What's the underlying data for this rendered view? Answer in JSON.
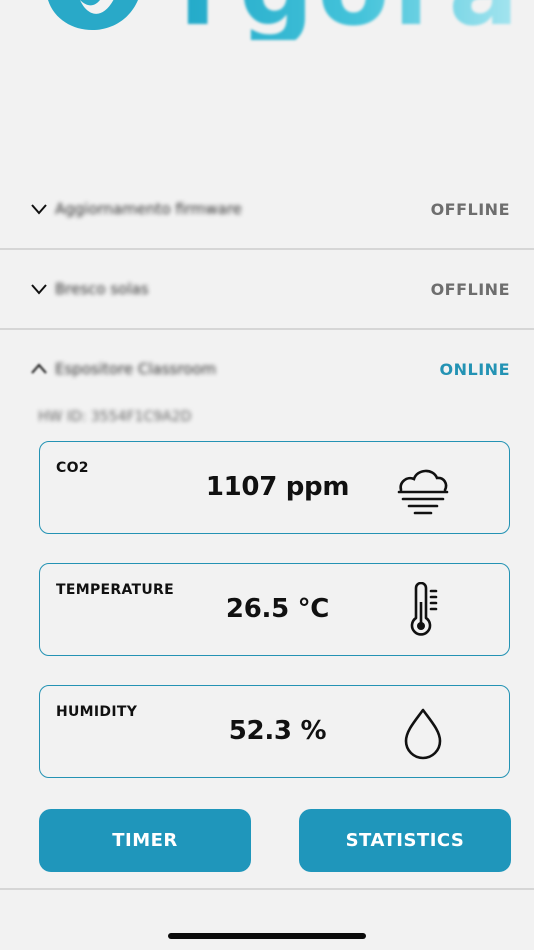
{
  "logo": {
    "text": "Ygora"
  },
  "devices": [
    {
      "name": "Aggiornamento firmware",
      "status": "OFFLINE",
      "expanded": false
    },
    {
      "name": "Bresco solas",
      "status": "OFFLINE",
      "expanded": false
    },
    {
      "name": "Espositore Classroom",
      "status": "ONLINE",
      "expanded": true,
      "hw_id": "HW ID: 3554F1C9A2D"
    }
  ],
  "readings": [
    {
      "label": "CO2",
      "value": "1107 ppm",
      "icon": "fog-cloud-icon"
    },
    {
      "label": "TEMPERATURE",
      "value": "26.5 °C",
      "icon": "thermometer-icon"
    },
    {
      "label": "HUMIDITY",
      "value": "52.3 %",
      "icon": "water-drop-icon"
    }
  ],
  "buttons": {
    "timer": "TIMER",
    "statistics": "STATISTICS"
  },
  "colors": {
    "accent": "#1f96bb",
    "offline": "#6e6e6e",
    "online": "#2493b4"
  }
}
